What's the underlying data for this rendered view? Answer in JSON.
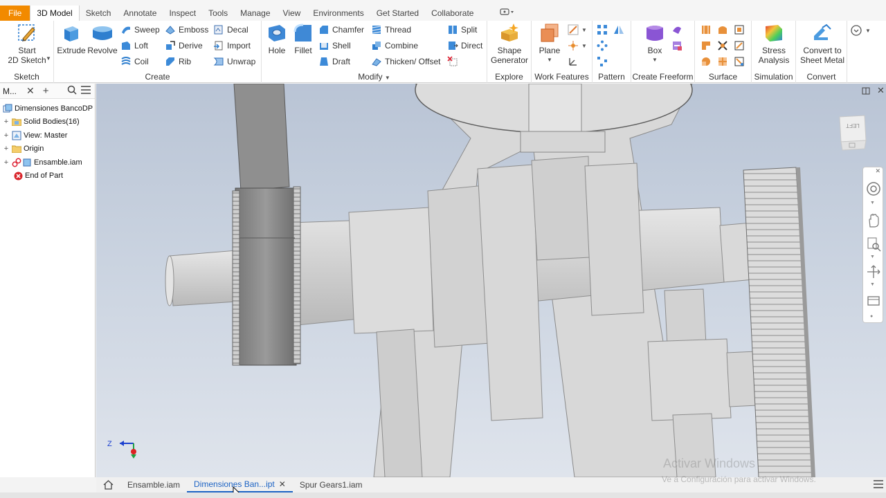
{
  "menu_tabs": [
    "File",
    "3D Model",
    "Sketch",
    "Annotate",
    "Inspect",
    "Tools",
    "Manage",
    "View",
    "Environments",
    "Get Started",
    "Collaborate"
  ],
  "ribbon": {
    "sketch": {
      "panel": "Sketch",
      "start": "Start",
      "start2": "2D Sketch"
    },
    "create": {
      "panel": "Create",
      "extrude": "Extrude",
      "revolve": "Revolve",
      "sweep": "Sweep",
      "loft": "Loft",
      "coil": "Coil",
      "emboss": "Emboss",
      "derive": "Derive",
      "rib": "Rib",
      "decal": "Decal",
      "import": "Import",
      "unwrap": "Unwrap"
    },
    "modify": {
      "panel": "Modify",
      "hole": "Hole",
      "fillet": "Fillet",
      "chamfer": "Chamfer",
      "shell": "Shell",
      "draft": "Draft",
      "thread": "Thread",
      "combine": "Combine",
      "thicken": "Thicken/ Offset",
      "split": "Split",
      "direct": "Direct"
    },
    "explore": {
      "panel": "Explore",
      "shape1": "Shape",
      "shape2": "Generator"
    },
    "work_features": {
      "panel": "Work Features",
      "plane": "Plane"
    },
    "pattern": {
      "panel": "Pattern"
    },
    "freeform": {
      "panel": "Create Freeform",
      "box": "Box"
    },
    "surface": {
      "panel": "Surface"
    },
    "simulation": {
      "panel": "Simulation",
      "stress1": "Stress",
      "stress2": "Analysis"
    },
    "convert": {
      "panel": "Convert",
      "conv1": "Convert to",
      "conv2": "Sheet Metal"
    }
  },
  "browser": {
    "title": "M...",
    "nodes": [
      {
        "label": "Dimensiones BancoDP",
        "expander": ""
      },
      {
        "label": "Solid Bodies(16)",
        "expander": "+"
      },
      {
        "label": "View: Master",
        "expander": "+"
      },
      {
        "label": "Origin",
        "expander": "+"
      },
      {
        "label": "Ensamble.iam",
        "expander": "+"
      },
      {
        "label": "End of Part",
        "expander": ""
      }
    ]
  },
  "viewcube_label": "LEFT",
  "triad": {
    "z": "Z"
  },
  "doc_tabs": [
    {
      "label": "Ensamble.iam",
      "active": false
    },
    {
      "label": "Dimensiones Ban...ipt",
      "active": true
    },
    {
      "label": "Spur Gears1.iam",
      "active": false
    }
  ],
  "watermark": {
    "title": "Activar Windows",
    "subtitle": "Ve a Configuración para activar Windows."
  },
  "colors": {
    "file_tab": "#f28a00",
    "active_doc": "#1c63c4",
    "model_gray": "#d0d0d0"
  }
}
